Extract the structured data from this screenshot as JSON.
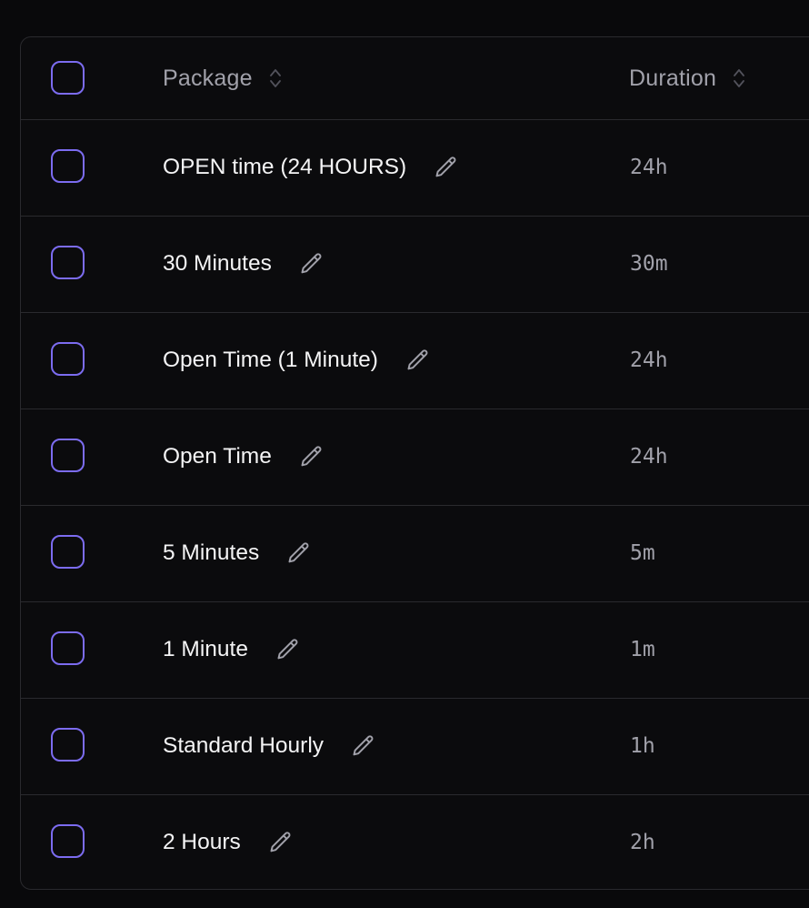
{
  "table": {
    "columns": {
      "package": "Package",
      "duration": "Duration"
    },
    "rows": [
      {
        "package": "OPEN time (24 HOURS)",
        "duration": "24h"
      },
      {
        "package": "30 Minutes",
        "duration": "30m"
      },
      {
        "package": "Open Time (1 Minute)",
        "duration": "24h"
      },
      {
        "package": "Open Time",
        "duration": "24h"
      },
      {
        "package": "5 Minutes",
        "duration": "5m"
      },
      {
        "package": "1 Minute",
        "duration": "1m"
      },
      {
        "package": "Standard Hourly",
        "duration": "1h"
      },
      {
        "package": "2 Hours",
        "duration": "2h"
      }
    ]
  },
  "icons": {
    "sort": "chevron-up-down-icon",
    "edit": "pencil-icon"
  },
  "colors": {
    "background": "#09090b",
    "checkbox_border": "#7c6cf0",
    "divider": "#2a2a2e",
    "header_text": "#a1a1aa",
    "primary_text": "#f4f4f5",
    "muted_text": "#a1a1aa"
  }
}
